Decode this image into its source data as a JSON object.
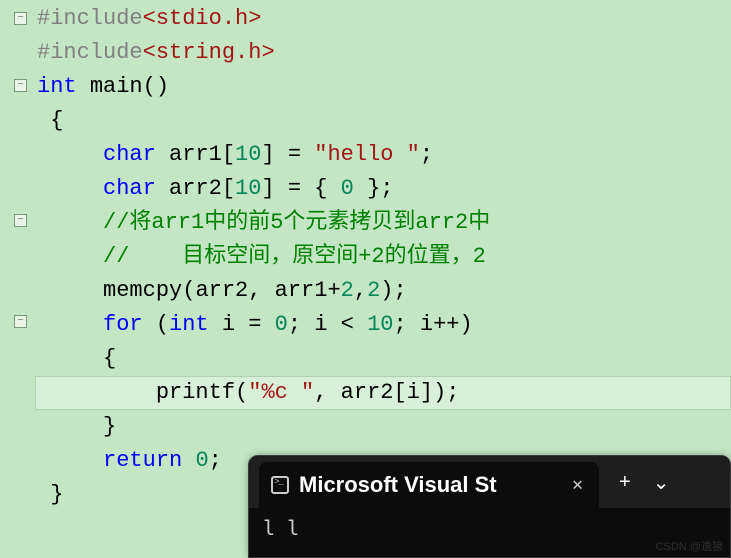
{
  "code": {
    "l1": {
      "pp": "#include",
      "hdr": "<stdio.h>"
    },
    "l2": {
      "pp": "#include",
      "hdr": "<string.h>"
    },
    "l3": {
      "kw1": "int",
      "fn": "main",
      "p": "()"
    },
    "l4": "{",
    "l5": {
      "kw": "char",
      "v": "arr1",
      "br": "[",
      "n": "10",
      "br2": "] = ",
      "s": "\"hello \"",
      "end": ";"
    },
    "l6": {
      "kw": "char",
      "v": "arr2",
      "br": "[",
      "n": "10",
      "br2": "] = { ",
      "z": "0",
      "end": " };"
    },
    "l7": "//将arr1中的前5个元素拷贝到arr2中",
    "l8": "//    目标空间，原空间+2的位置，2",
    "l9": {
      "fn": "memcpy",
      "p1": "(",
      "a1": "arr2",
      "c1": ", ",
      "a2": "arr1",
      "plus": "+",
      "n1": "2",
      "c2": ",",
      "n2": "2",
      "p2": ");"
    },
    "l10": {
      "kw": "for",
      "p1": " (",
      "ty": "int",
      "v": " i",
      "eq": " = ",
      "z": "0",
      "sc1": "; ",
      "v2": "i",
      "lt": " < ",
      "n": "10",
      "sc2": "; ",
      "v3": "i",
      "pp": "++",
      "p2": ")"
    },
    "l11": "{",
    "l12": {
      "fn": "printf",
      "p1": "(",
      "s": "\"%c \"",
      "c": ", ",
      "a": "arr2",
      "br1": "[",
      "i": "i",
      "br2": "]",
      "p2": ");"
    },
    "l13": "}",
    "l14": {
      "kw": "return",
      "sp": " ",
      "n": "0",
      "end": ";"
    },
    "l15": "}"
  },
  "fold": {
    "minus": "−"
  },
  "terminal": {
    "title": "Microsoft Visual St",
    "close": "✕",
    "plus": "+",
    "chevron": "⌄",
    "output": "l l"
  },
  "watermark": "CSDN @逸狼"
}
